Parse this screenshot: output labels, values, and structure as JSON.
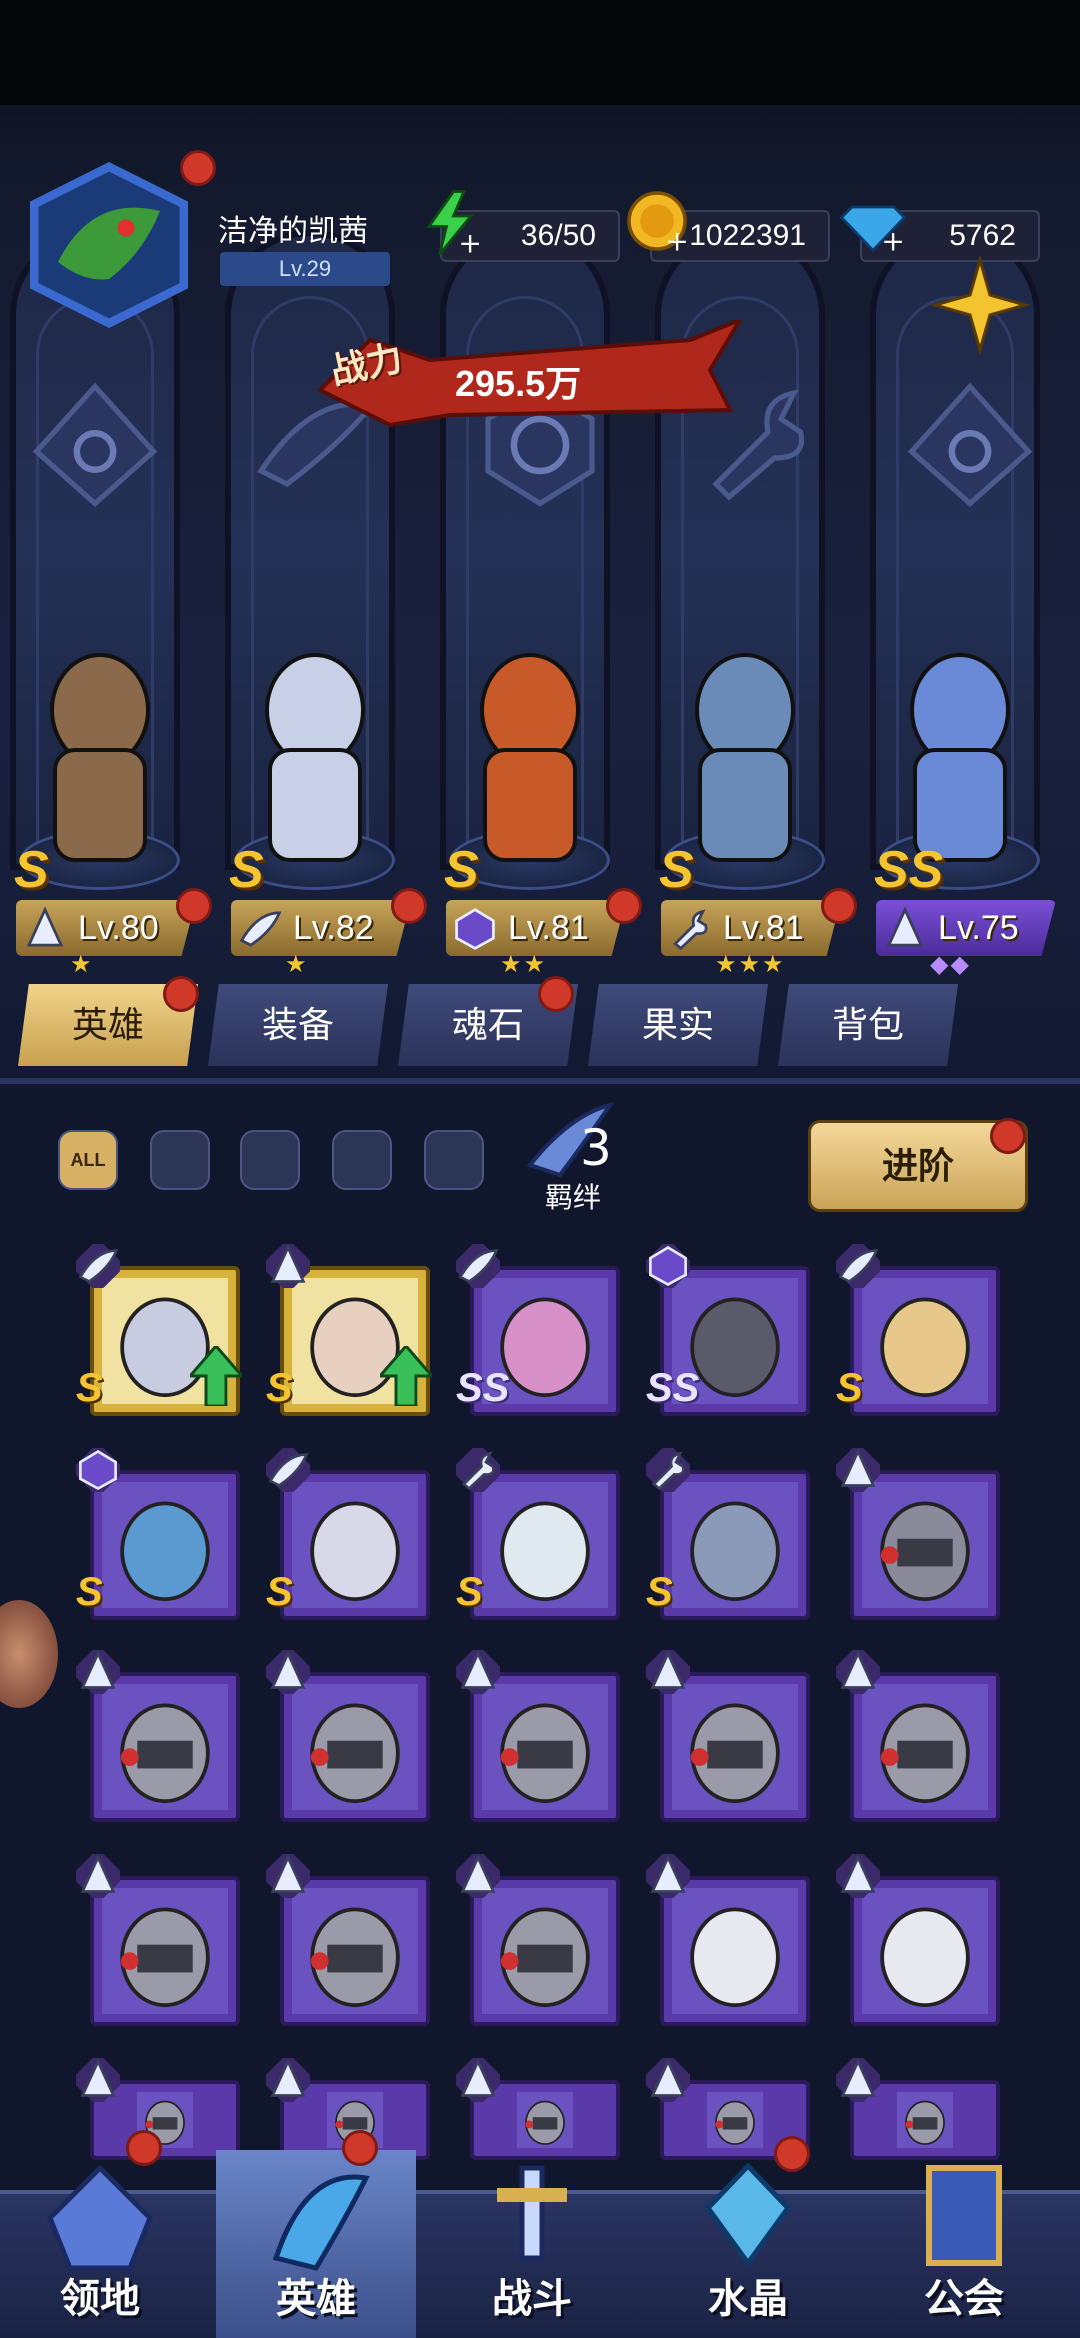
{
  "player": {
    "name": "洁净的凯茜",
    "level": "Lv.29"
  },
  "resources": {
    "stamina": "36/50",
    "gold": "1022391",
    "diamonds": "5762"
  },
  "power": {
    "label": "战力",
    "value": "295.5万"
  },
  "lineup": [
    {
      "rank": "S",
      "level": "Lv.80",
      "class_icon": "mage-hat-icon",
      "stars": "★",
      "plate": "gold"
    },
    {
      "rank": "S",
      "level": "Lv.82",
      "class_icon": "wing-icon",
      "stars": "★",
      "plate": "gold"
    },
    {
      "rank": "S",
      "level": "Lv.81",
      "class_icon": "beast-icon",
      "stars": "★★",
      "plate": "gold"
    },
    {
      "rank": "S",
      "level": "Lv.81",
      "class_icon": "wrench-icon",
      "stars": "★★★",
      "plate": "gold"
    },
    {
      "rank": "SS",
      "level": "Lv.75",
      "class_icon": "mage-hat-icon",
      "stars": "◆◆",
      "plate": "purple"
    }
  ],
  "tabs": [
    "英雄",
    "装备",
    "魂石",
    "果实",
    "背包"
  ],
  "filters": {
    "all_label": "ALL",
    "bond_label": "羁绊",
    "advance_label": "进阶"
  },
  "cards": [
    {
      "frame": "gold",
      "rank": "S",
      "class_icon": "wing-icon",
      "upgrade": true
    },
    {
      "frame": "gold",
      "rank": "S",
      "class_icon": "mage-hat-icon",
      "upgrade": true
    },
    {
      "frame": "purple",
      "rank": "SS",
      "class_icon": "wing-icon",
      "upgrade": false
    },
    {
      "frame": "purple",
      "rank": "SS",
      "class_icon": "beast-icon",
      "upgrade": false
    },
    {
      "frame": "purple",
      "rank": "S",
      "class_icon": "wing-icon",
      "upgrade": false
    },
    {
      "frame": "purple",
      "rank": "S",
      "class_icon": "beast-icon",
      "upgrade": false
    },
    {
      "frame": "purple",
      "rank": "S",
      "class_icon": "wing-icon",
      "upgrade": false
    },
    {
      "frame": "purple",
      "rank": "S",
      "class_icon": "wrench-icon",
      "upgrade": false
    },
    {
      "frame": "purple",
      "rank": "S",
      "class_icon": "wrench-icon",
      "upgrade": false
    },
    {
      "frame": "purple",
      "rank": "",
      "class_icon": "mage-hat-icon",
      "upgrade": false
    }
  ],
  "nav": [
    {
      "label": "领地"
    },
    {
      "label": "英雄"
    },
    {
      "label": "战斗"
    },
    {
      "label": "水晶"
    },
    {
      "label": "公会"
    }
  ],
  "colors": {
    "gold": "#d7b33e",
    "purple_frame": "#5a3aa8",
    "badge_red": "#d0382a"
  }
}
